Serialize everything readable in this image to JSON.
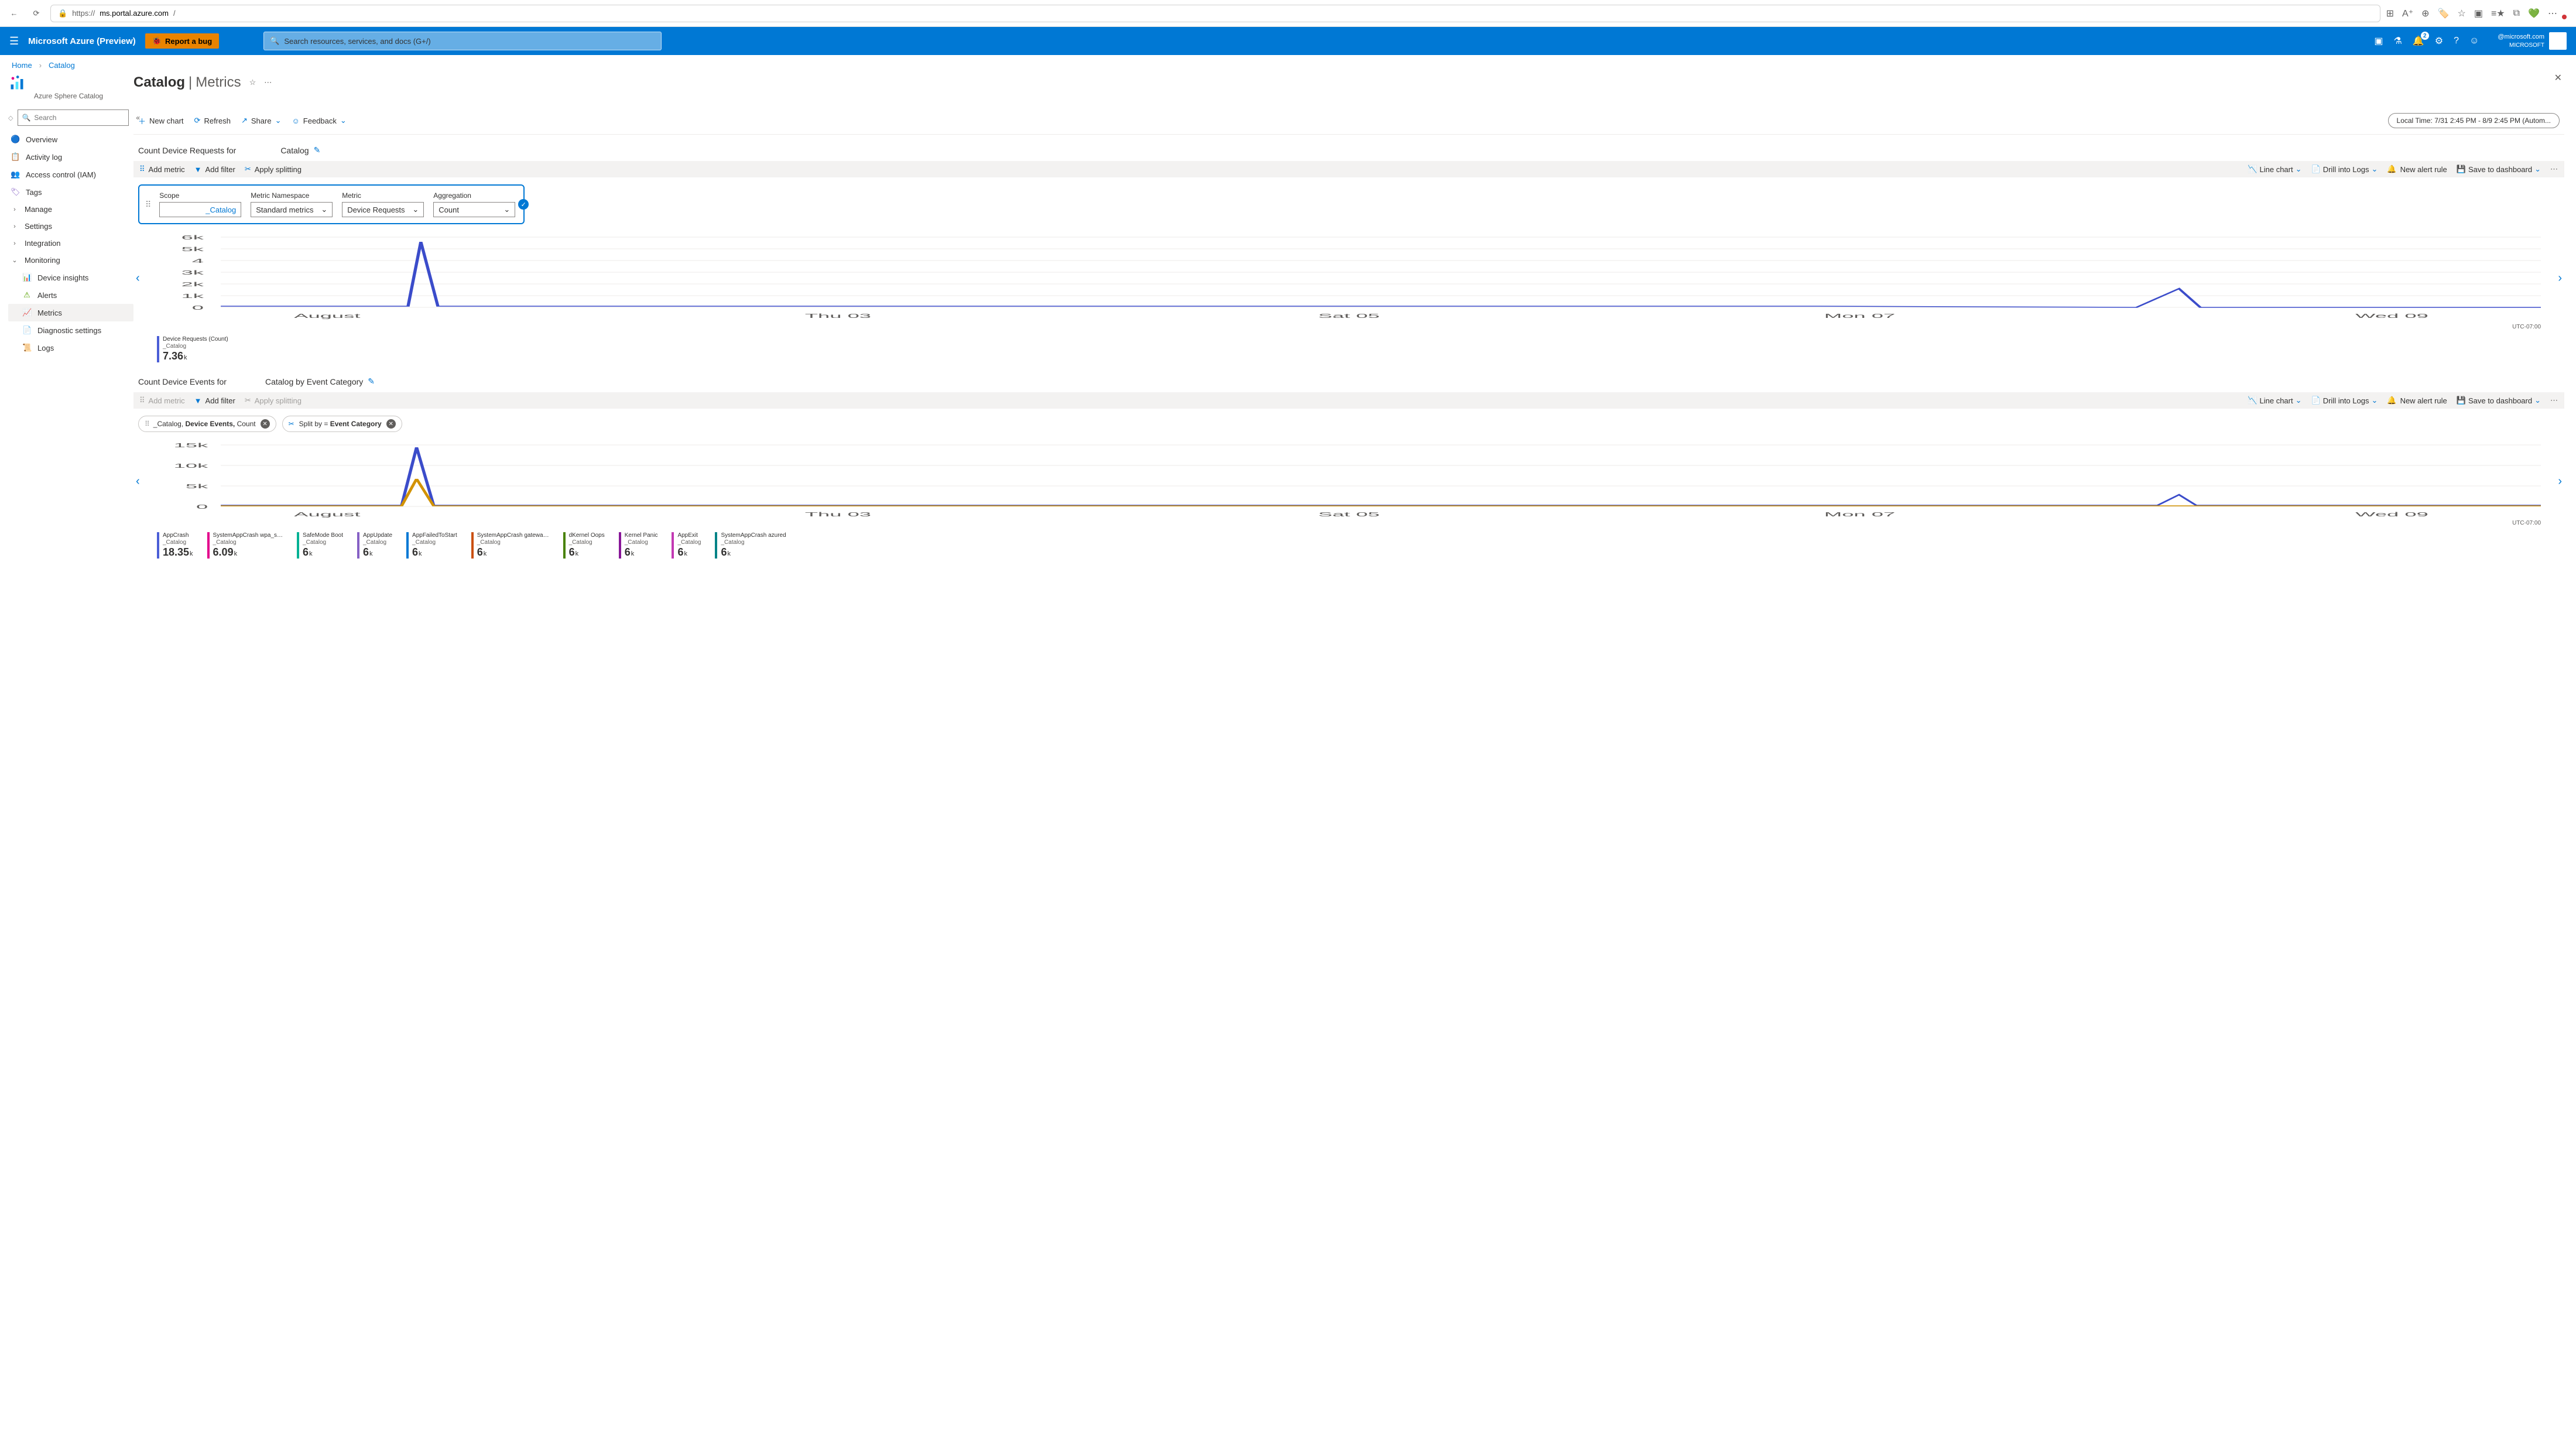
{
  "browser": {
    "url_prefix": "https://",
    "url_domain": "ms.portal.azure.com",
    "url_path": "/"
  },
  "azure": {
    "product": "Microsoft Azure (Preview)",
    "bug": "Report a bug",
    "search_placeholder": "Search resources, services, and docs (G+/)",
    "notif_badge": "2",
    "account_email": "@microsoft.com",
    "account_org": "MICROSOFT"
  },
  "breadcrumb": {
    "home": "Home",
    "catalog": "Catalog"
  },
  "page": {
    "title": "Catalog",
    "subtitle_sep": "|",
    "section": "Metrics",
    "kind": "Azure Sphere Catalog"
  },
  "leftnav": {
    "search_placeholder": "Search",
    "overview": "Overview",
    "activity": "Activity log",
    "access": "Access control (IAM)",
    "tags": "Tags",
    "manage": "Manage",
    "settings": "Settings",
    "integration": "Integration",
    "monitoring": "Monitoring",
    "device_insights": "Device insights",
    "alerts": "Alerts",
    "metrics": "Metrics",
    "diagnostics": "Diagnostic settings",
    "logs": "Logs"
  },
  "commands": {
    "new_chart": "New chart",
    "refresh": "Refresh",
    "share": "Share",
    "feedback": "Feedback",
    "time_range": "Local Time: 7/31 2:45 PM - 8/9 2:45 PM (Autom..."
  },
  "chart1": {
    "title_prefix": "Count Device Requests for",
    "title_suffix": "Catalog",
    "add_metric": "Add metric",
    "add_filter": "Add filter",
    "apply_splitting": "Apply splitting",
    "line_chart": "Line chart",
    "drill_logs": "Drill into Logs",
    "new_alert": "New alert rule",
    "save_dash": "Save to dashboard",
    "config": {
      "scope_label": "Scope",
      "scope_value": "_Catalog",
      "ns_label": "Metric Namespace",
      "ns_value": "Standard metrics",
      "metric_label": "Metric",
      "metric_value": "Device Requests",
      "agg_label": "Aggregation",
      "agg_value": "Count"
    },
    "summary": {
      "label": "Device Requests (Count)",
      "sub": "_Catalog",
      "value": "7.36",
      "unit": "k"
    },
    "tz": "UTC-07:00"
  },
  "chart2": {
    "title_prefix": "Count Device Events for",
    "title_mid": "Catalog by Event Category",
    "chip_scope": "_Catalog,",
    "chip_metric": "Device Events,",
    "chip_agg": "Count",
    "split_prefix": "Split by = ",
    "split_value": "Event Category",
    "tz": "UTC-07:00",
    "legend": [
      {
        "name": "AppCrash",
        "sub": "_Catalog",
        "value": "18.35",
        "unit": "k",
        "color": "#4b5ed7"
      },
      {
        "name": "SystemAppCrash wpa_s…",
        "sub": "_Catalog",
        "value": "6.09",
        "unit": "k",
        "color": "#e3008c"
      },
      {
        "name": "SafeMode Boot",
        "sub": "_Catalog",
        "value": "6",
        "unit": "k",
        "color": "#00b294"
      },
      {
        "name": "AppUpdate",
        "sub": "_Catalog",
        "value": "6",
        "unit": "k",
        "color": "#8661c5"
      },
      {
        "name": "AppFailedToStart",
        "sub": "_Catalog",
        "value": "6",
        "unit": "k",
        "color": "#0078d4"
      },
      {
        "name": "SystemAppCrash gatewa…",
        "sub": "_Catalog",
        "value": "6",
        "unit": "k",
        "color": "#ca5010"
      },
      {
        "name": "dKernel Oops",
        "sub": "_Catalog",
        "value": "6",
        "unit": "k",
        "color": "#498205"
      },
      {
        "name": "Kernel Panic",
        "sub": "_Catalog",
        "value": "6",
        "unit": "k",
        "color": "#881798"
      },
      {
        "name": "AppExit",
        "sub": "_Catalog",
        "value": "6",
        "unit": "k",
        "color": "#c239b3"
      },
      {
        "name": "SystemAppCrash azured",
        "sub": "_Catalog",
        "value": "6",
        "unit": "k",
        "color": "#038387"
      }
    ]
  },
  "chart_data": [
    {
      "type": "line",
      "title": "Device Requests (Count) — _Catalog",
      "ylabel": "",
      "ylim": [
        0,
        6000
      ],
      "yticks": [
        0,
        1000,
        2000,
        3000,
        4000,
        5000,
        6000
      ],
      "xticks": [
        "August",
        "Thu 03",
        "Sat 05",
        "Mon 07",
        "Wed 09"
      ],
      "series": [
        {
          "name": "Device Requests",
          "approx_values": [
            50,
            50,
            5200,
            50,
            50,
            50,
            50,
            50,
            50,
            50,
            50,
            50,
            50,
            50,
            50,
            50,
            1200,
            50,
            50
          ]
        }
      ]
    },
    {
      "type": "line",
      "title": "Device Events (Count) by Event Category — _Catalog",
      "ylabel": "",
      "ylim": [
        0,
        15000
      ],
      "yticks": [
        0,
        5000,
        10000,
        15000
      ],
      "xticks": [
        "August",
        "Thu 03",
        "Sat 05",
        "Mon 07",
        "Wed 09"
      ],
      "series": [
        {
          "name": "AppCrash",
          "approx_values": [
            50,
            50,
            13500,
            50,
            50,
            50,
            50,
            50,
            50,
            50,
            50,
            50,
            50,
            50,
            50,
            50,
            1200,
            50,
            50
          ]
        },
        {
          "name": "SystemAppCrash wpa_s",
          "approx_values": [
            50,
            50,
            6000,
            50,
            50,
            50,
            50,
            50,
            50,
            50,
            50,
            50,
            50,
            50,
            50,
            50,
            50,
            50,
            50
          ]
        }
      ]
    }
  ]
}
